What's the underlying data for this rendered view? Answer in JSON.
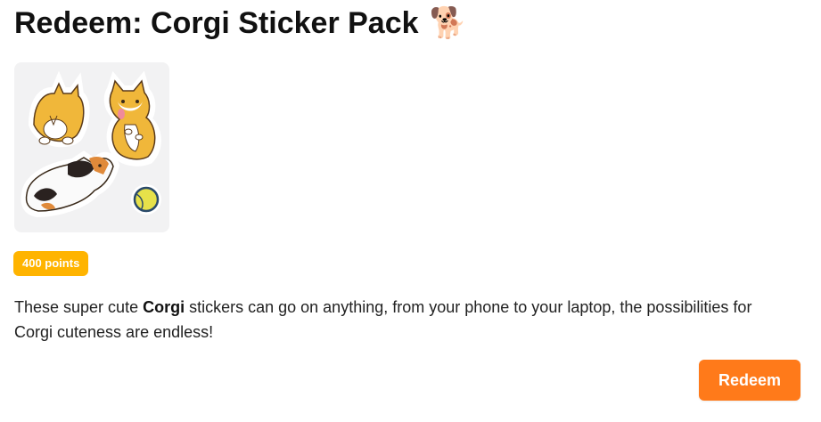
{
  "header": {
    "title": "Redeem: Corgi Sticker Pack",
    "title_emoji": "🐕"
  },
  "product": {
    "image_icon": "corgi-stickers-image",
    "points_label": "400 points",
    "description_before": "These super cute ",
    "description_bold": "Corgi",
    "description_after": " stickers can go on anything, from your phone to your laptop, the possibilities for Corgi cuteness are endless!"
  },
  "actions": {
    "redeem_label": "Redeem"
  },
  "colors": {
    "badge": "#ffb400",
    "button": "#ff7a1a",
    "image_bg": "#f2f2f3"
  }
}
